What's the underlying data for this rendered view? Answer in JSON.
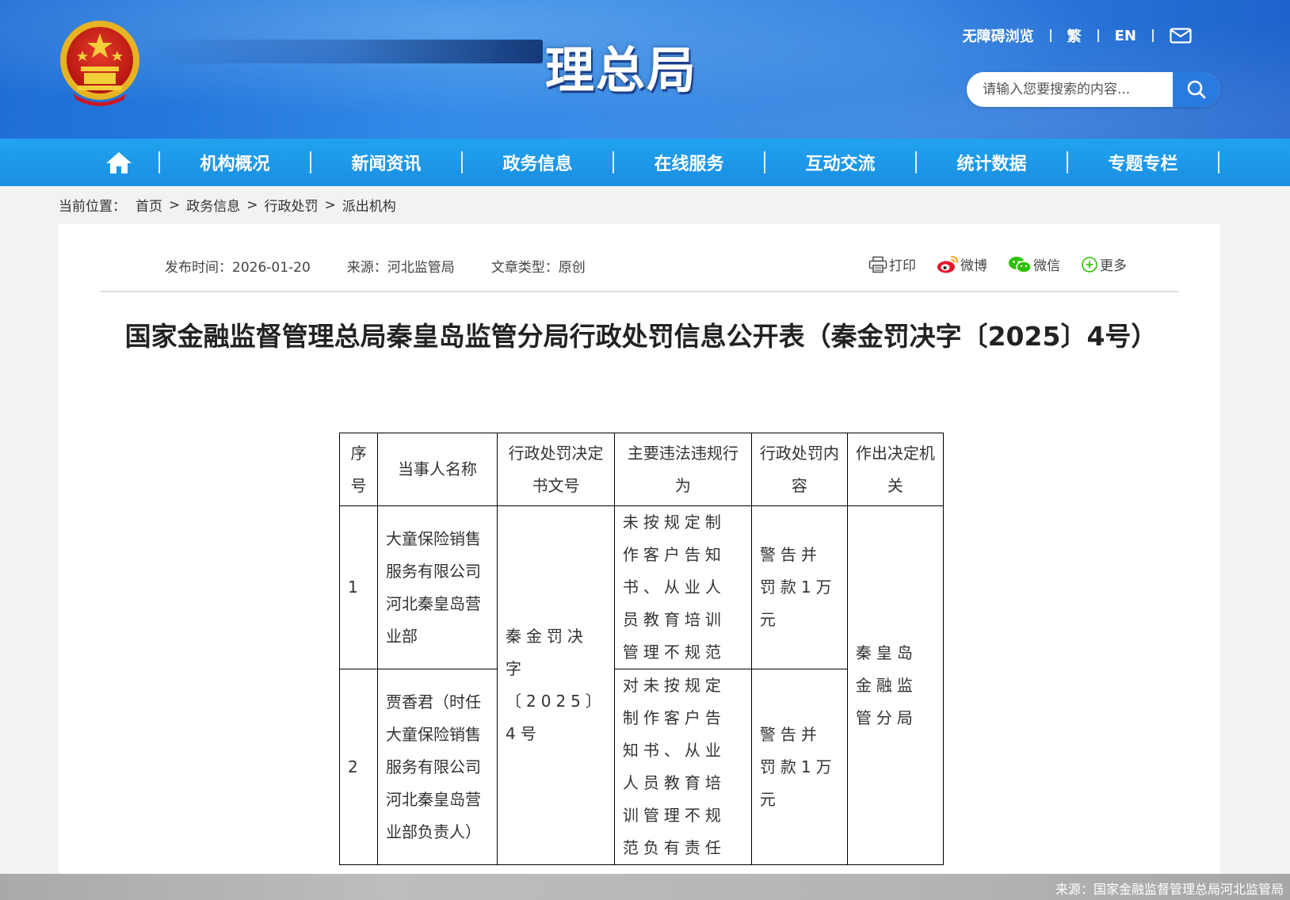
{
  "header": {
    "logo_text": "理总局",
    "top_links": [
      {
        "label": "无障碍浏览"
      },
      {
        "label": "繁"
      },
      {
        "label": "EN"
      }
    ],
    "search_placeholder": "请输入您要搜索的内容..."
  },
  "nav": {
    "items": [
      {
        "label": "机构概况"
      },
      {
        "label": "新闻资讯"
      },
      {
        "label": "政务信息"
      },
      {
        "label": "在线服务"
      },
      {
        "label": "互动交流"
      },
      {
        "label": "统计数据"
      },
      {
        "label": "专题专栏"
      }
    ]
  },
  "breadcrumb": {
    "lead": "当前位置：",
    "items": [
      "首页",
      "政务信息",
      "行政处罚",
      "派出机构"
    ],
    "arrow": ">"
  },
  "meta": {
    "publish_time": "发布时间：2026-01-20",
    "source": "来源：河北监管局",
    "article_type": "文章类型：原创"
  },
  "share": {
    "print": "打印",
    "weibo": "微博",
    "wechat": "微信",
    "more": "更多"
  },
  "article": {
    "title": "国家金融监督管理总局秦皇岛监管分局行政处罚信息公开表（秦金罚决字〔2025〕4号）"
  },
  "table": {
    "headers": [
      "序号",
      "当事人名称",
      "行政处罚决定书文号",
      "主要违法违规行为",
      "行政处罚内容",
      "作出决定机关"
    ],
    "rows": [
      {
        "seq": "1",
        "party": "大童保险销售服务有限公司河北秦皇岛营业部",
        "violation": "未按规定制作客户告知书、从业人员教育培训管理不规范",
        "penalty": "警告并罚款1万元"
      },
      {
        "seq": "2",
        "party": "贾香君（时任大童保险销售服务有限公司河北秦皇岛营业部负责人）",
        "violation": "对未按规定制作客户告知书、从业人员教育培训管理不规范负有责任",
        "penalty": "警告并罚款1万元"
      }
    ],
    "doc_number": "秦金罚决字〔2025〕4号",
    "authority": "秦皇岛金融监管分局"
  },
  "footer": {
    "source": "来源：国家金融监督管理总局河北监管局"
  },
  "colors": {
    "header_blue": "#2b86e6",
    "nav_blue": "#1a8fe2",
    "search_button": "#2a7be0"
  }
}
